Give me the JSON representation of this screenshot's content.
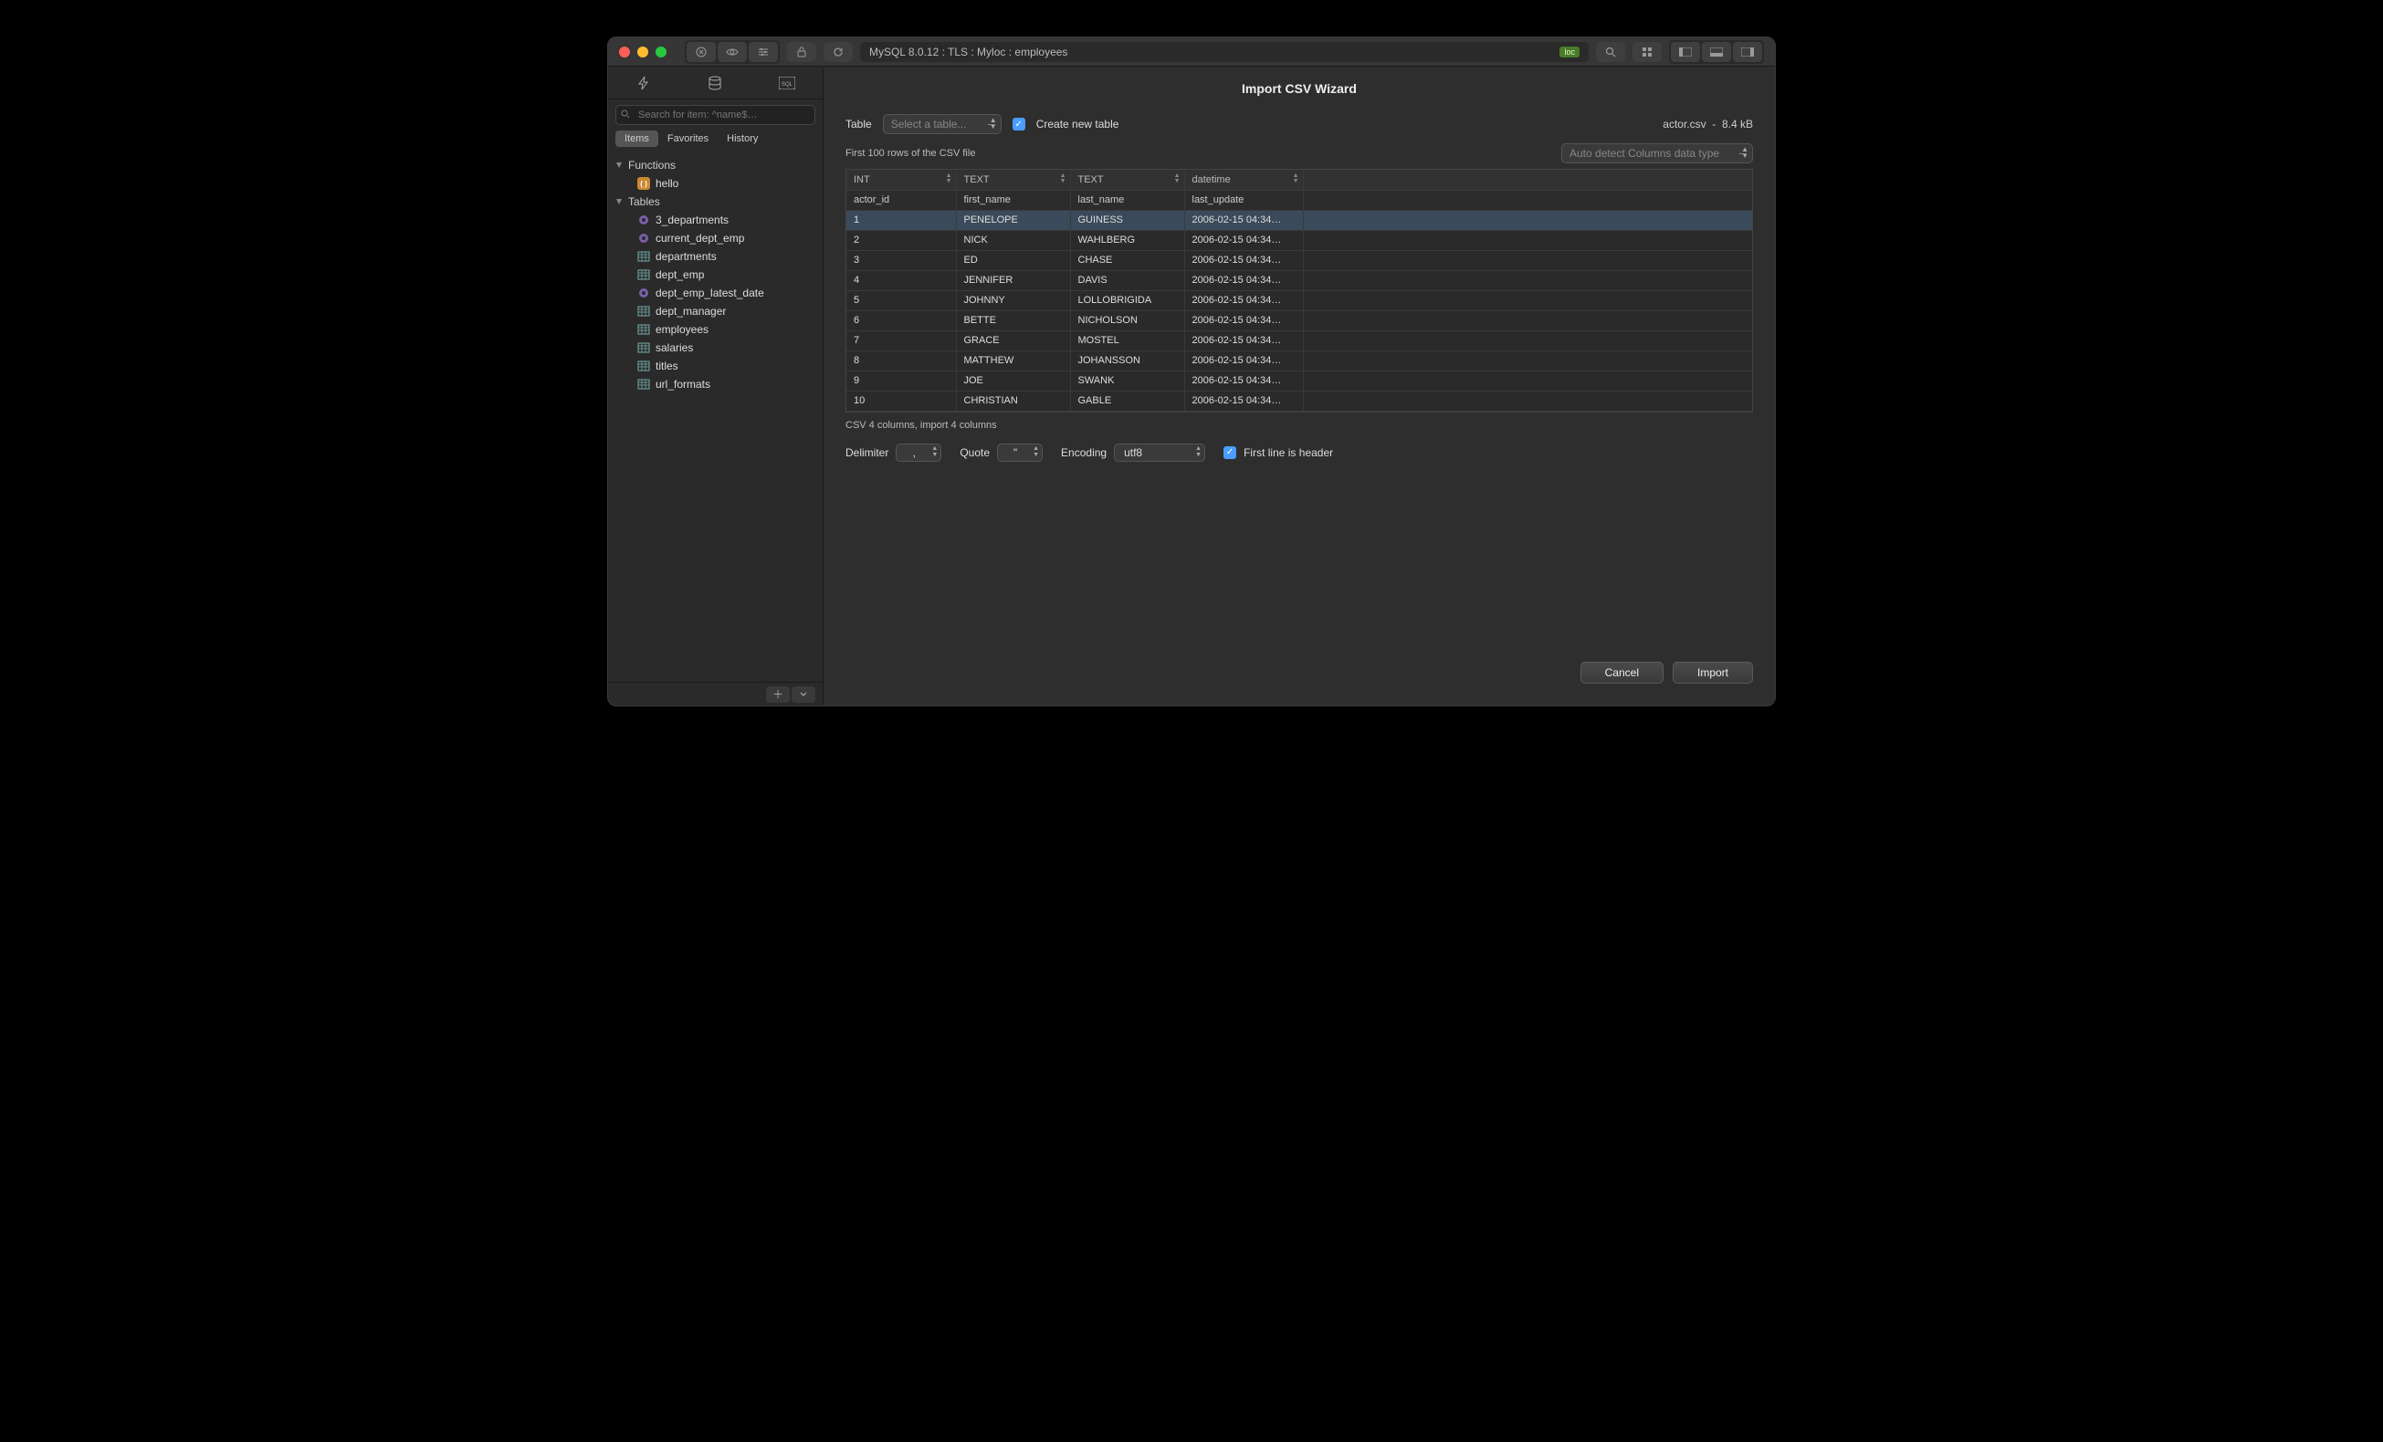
{
  "titlebar": {
    "path": "MySQL 8.0.12 : TLS : Myloc : employees",
    "loc_badge": "loc"
  },
  "sidebar": {
    "search_placeholder": "Search for item: ^name$…",
    "filter_tabs": [
      "Items",
      "Favorites",
      "History"
    ],
    "active_filter": 0,
    "group_functions": "Functions",
    "functions": [
      {
        "label": "hello",
        "icon": "fn"
      }
    ],
    "group_tables": "Tables",
    "tables": [
      {
        "label": "3_departments",
        "icon": "view"
      },
      {
        "label": "current_dept_emp",
        "icon": "view"
      },
      {
        "label": "departments",
        "icon": "table"
      },
      {
        "label": "dept_emp",
        "icon": "table"
      },
      {
        "label": "dept_emp_latest_date",
        "icon": "view"
      },
      {
        "label": "dept_manager",
        "icon": "table"
      },
      {
        "label": "employees",
        "icon": "table"
      },
      {
        "label": "salaries",
        "icon": "table"
      },
      {
        "label": "titles",
        "icon": "table"
      },
      {
        "label": "url_formats",
        "icon": "table"
      }
    ]
  },
  "wizard": {
    "title": "Import CSV Wizard",
    "table_label": "Table",
    "table_select_placeholder": "Select a table...",
    "create_new_label": "Create new table",
    "file_name": "actor.csv",
    "file_sep": "-",
    "file_size": "8.4 kB",
    "first_rows_label": "First 100 rows of the CSV file",
    "auto_detect_label": "Auto detect Columns data type",
    "col_types": [
      "INT",
      "TEXT",
      "TEXT",
      "datetime"
    ],
    "col_names": [
      "actor_id",
      "first_name",
      "last_name",
      "last_update"
    ],
    "rows": [
      [
        "1",
        "PENELOPE",
        "GUINESS",
        "2006-02-15 04:34…"
      ],
      [
        "2",
        "NICK",
        "WAHLBERG",
        "2006-02-15 04:34…"
      ],
      [
        "3",
        "ED",
        "CHASE",
        "2006-02-15 04:34…"
      ],
      [
        "4",
        "JENNIFER",
        "DAVIS",
        "2006-02-15 04:34…"
      ],
      [
        "5",
        "JOHNNY",
        "LOLLOBRIGIDA",
        "2006-02-15 04:34…"
      ],
      [
        "6",
        "BETTE",
        "NICHOLSON",
        "2006-02-15 04:34…"
      ],
      [
        "7",
        "GRACE",
        "MOSTEL",
        "2006-02-15 04:34…"
      ],
      [
        "8",
        "MATTHEW",
        "JOHANSSON",
        "2006-02-15 04:34…"
      ],
      [
        "9",
        "JOE",
        "SWANK",
        "2006-02-15 04:34…"
      ],
      [
        "10",
        "CHRISTIAN",
        "GABLE",
        "2006-02-15 04:34…"
      ]
    ],
    "summary": "CSV 4 columns, import 4 columns",
    "delimiter_label": "Delimiter",
    "delimiter_value": ",",
    "quote_label": "Quote",
    "quote_value": "\"",
    "encoding_label": "Encoding",
    "encoding_value": "utf8",
    "first_line_header_label": "First line is header",
    "cancel_label": "Cancel",
    "import_label": "Import"
  }
}
